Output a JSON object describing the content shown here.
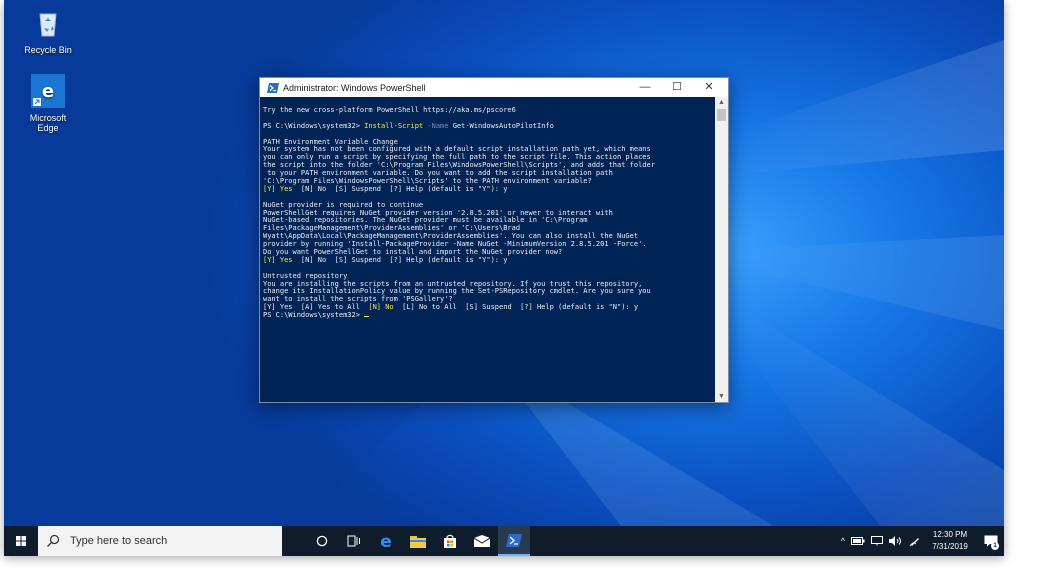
{
  "desktop": {
    "icons": [
      {
        "label": "Recycle Bin"
      },
      {
        "label": "Microsoft Edge"
      }
    ]
  },
  "window": {
    "title": "Administrator: Windows PowerShell",
    "controls": {
      "minimize": "—",
      "maximize": "☐",
      "close": "✕"
    },
    "scroll_up": "▲",
    "scroll_down": "▼",
    "lines": [
      {
        "text": "Try the new cross-platform PowerShell https://aka.ms/pscore6"
      },
      {
        "text": ""
      },
      {
        "prompt": "PS C:\\Windows\\system32> ",
        "cmd": "Install-Script",
        "param": " -Name ",
        "arg": "Get-WindowsAutoPilotInfo"
      },
      {
        "text": ""
      },
      {
        "text": "PATH Environment Variable Change"
      },
      {
        "text": "Your system has not been configured with a default script installation path yet, which means"
      },
      {
        "text": "you can only run a script by specifying the full path to the script file. This action places"
      },
      {
        "text": "the script into the folder 'C:\\Program Files\\WindowsPowerShell\\Scripts', and adds that folder"
      },
      {
        "text": " to your PATH environment variable. Do you want to add the script installation path"
      },
      {
        "text": "'C:\\Program Files\\WindowsPowerShell\\Scripts' to the PATH environment variable?"
      },
      {
        "hl": "[Y] Yes ",
        "text": " [N] No  [S] Suspend  [?] Help (default is \"Y\"): y"
      },
      {
        "text": ""
      },
      {
        "text": "NuGet provider is required to continue"
      },
      {
        "text": "PowerShellGet requires NuGet provider version '2.8.5.201' or newer to interact with"
      },
      {
        "text": "NuGet-based repositories. The NuGet provider must be available in 'C:\\Program"
      },
      {
        "text": "Files\\PackageManagement\\ProviderAssemblies' or 'C:\\Users\\Brad"
      },
      {
        "text": "Wyatt\\AppData\\Local\\PackageManagement\\ProviderAssemblies'. You can also install the NuGet"
      },
      {
        "text": "provider by running 'Install-PackageProvider -Name NuGet -MinimumVersion 2.8.5.201 -Force'."
      },
      {
        "text": "Do you want PowerShellGet to install and import the NuGet provider now?"
      },
      {
        "hl": "[Y] Yes ",
        "text": " [N] No  [S] Suspend  [?] Help (default is \"Y\"): y"
      },
      {
        "text": ""
      },
      {
        "text": "Untrusted repository"
      },
      {
        "text": "You are installing the scripts from an untrusted repository. If you trust this repository,"
      },
      {
        "text": "change its InstallationPolicy value by running the Set-PSRepository cmdlet. Are you sure you"
      },
      {
        "text": "want to install the scripts from 'PSGallery'?"
      },
      {
        "pre": "[Y] Yes  [A] Yes to All  ",
        "hl": "[N] No ",
        "text": " [L] No to All  [S] Suspend  [?] Help (default is \"N\"): y"
      },
      {
        "prompt": "PS C:\\Windows\\system32> ",
        "cursor": true
      }
    ]
  },
  "taskbar": {
    "search_placeholder": "Type here to search",
    "clock_time": "12:30 PM",
    "clock_date": "7/31/2019",
    "notification_count": "1",
    "tray_chevron": "^"
  }
}
